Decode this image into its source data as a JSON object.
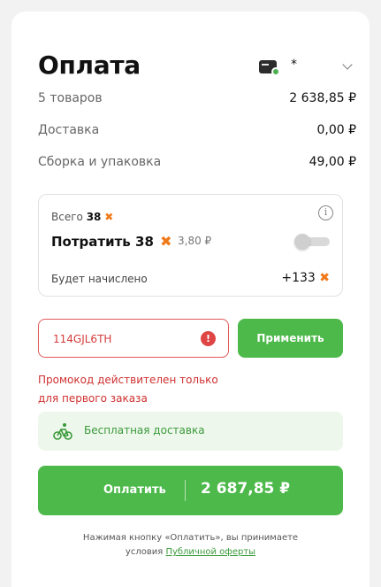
{
  "header": {
    "title": "Оплата",
    "card_mask": "*"
  },
  "summary": [
    {
      "label": "5 товаров",
      "value": "2 638,85 ₽"
    },
    {
      "label": "Доставка",
      "value": "0,00 ₽"
    },
    {
      "label": "Сборка и упаковка",
      "value": "49,00 ₽"
    }
  ],
  "bonus": {
    "total_label": "Всего",
    "total_value": "38",
    "spend_label": "Потратить 38",
    "spend_equivalent": "3,80 ₽",
    "spend_enabled": false,
    "accrue_label": "Будет начислено",
    "accrue_value": "+133"
  },
  "promo": {
    "code": "114GJL6TH",
    "apply_label": "Применить",
    "error_line1": "Промокод действителен только",
    "error_line2": "для первого заказа"
  },
  "free_delivery": "Бесплатная доставка",
  "pay_button": {
    "label": "Оплатить",
    "sum": "2 687,85 ₽"
  },
  "terms": {
    "text": "Нажимая кнопку «Оплатить», вы принимаете",
    "prefix": "условия",
    "link": "Публичной оферты"
  },
  "colors": {
    "accent_green": "#4cb94a",
    "error_red": "#cf3030",
    "bonus_orange": "#f07a1a"
  }
}
